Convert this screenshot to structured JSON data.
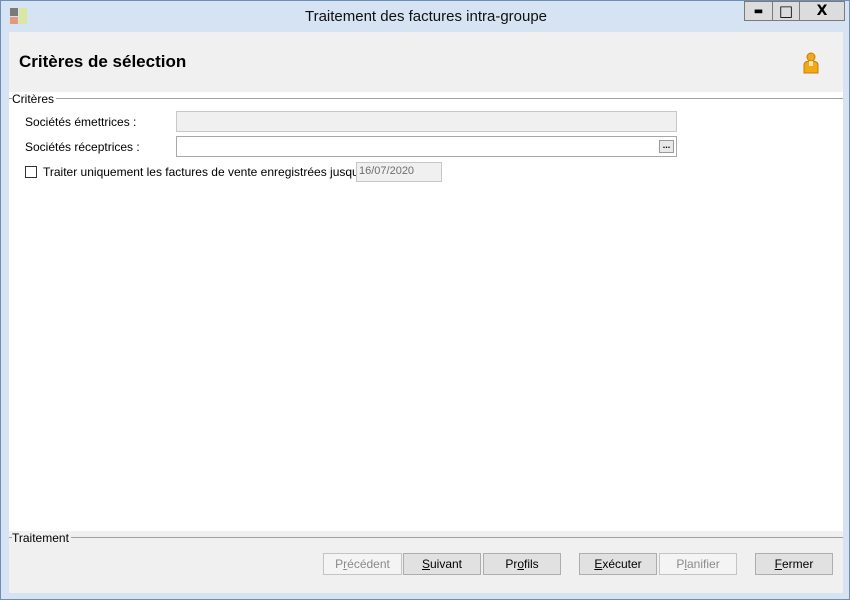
{
  "window": {
    "title": "Traitement des factures intra-groupe",
    "minimize_glyph": "▬",
    "maximize_glyph": "□",
    "close_glyph": "X",
    "app_icon": "app-icon"
  },
  "header": {
    "title": "Critères de sélection",
    "user_icon": "person-icon"
  },
  "criteria": {
    "group_label": "Critères",
    "emitting_label": "Sociétés émettrices :",
    "emitting_value": "",
    "receiving_label": "Sociétés réceptrices :",
    "receiving_value": "",
    "browse_glyph": "...",
    "only_sales_label": "Traiter uniquement les factures de vente enregistrées jusqu'au :",
    "only_sales_checked": false,
    "date_value": "16/07/2020"
  },
  "processing": {
    "group_label": "Traitement",
    "buttons": {
      "previous": {
        "pre": "P",
        "accel": "r",
        "post": "écédent",
        "enabled": false
      },
      "next": {
        "pre": "",
        "accel": "S",
        "post": "uivant",
        "enabled": true
      },
      "profiles": {
        "pre": "Pr",
        "accel": "o",
        "post": "fils",
        "enabled": true
      },
      "execute": {
        "pre": "",
        "accel": "E",
        "post": "xécuter",
        "enabled": true
      },
      "schedule": {
        "pre": "P",
        "accel": "l",
        "post": "anifier",
        "enabled": false
      },
      "close": {
        "pre": "",
        "accel": "F",
        "post": "ermer",
        "enabled": true
      }
    }
  }
}
